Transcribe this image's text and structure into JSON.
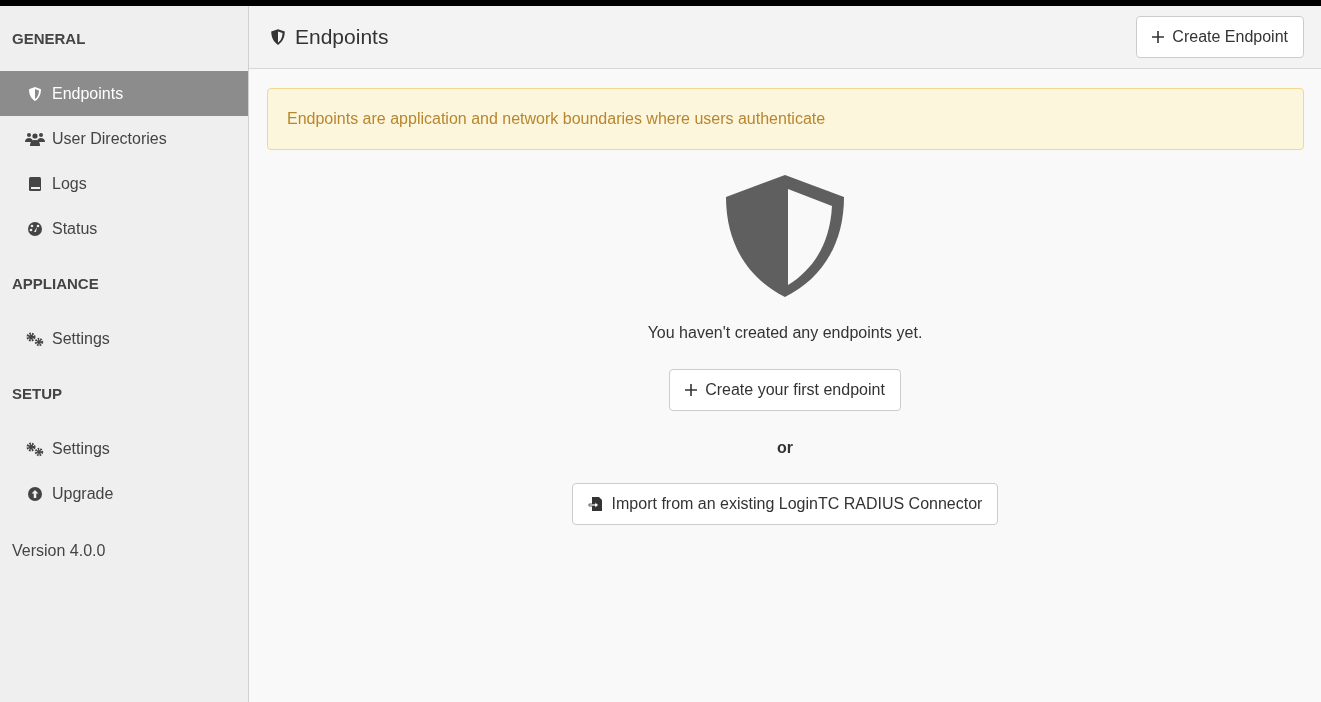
{
  "sidebar": {
    "sections": [
      {
        "heading": "GENERAL",
        "items": [
          {
            "label": "Endpoints",
            "kind": "shield",
            "selected": true
          },
          {
            "label": "User Directories",
            "kind": "users",
            "selected": false
          },
          {
            "label": "Logs",
            "kind": "book",
            "selected": false
          },
          {
            "label": "Status",
            "kind": "gauge",
            "selected": false
          }
        ]
      },
      {
        "heading": "APPLIANCE",
        "items": [
          {
            "label": "Settings",
            "kind": "gears",
            "selected": false
          }
        ]
      },
      {
        "heading": "SETUP",
        "items": [
          {
            "label": "Settings",
            "kind": "gears",
            "selected": false
          },
          {
            "label": "Upgrade",
            "kind": "upgrade",
            "selected": false
          }
        ]
      }
    ],
    "version": "Version 4.0.0"
  },
  "header": {
    "title": "Endpoints",
    "button": "Create Endpoint"
  },
  "alert": "Endpoints are application and network boundaries where users authenticate",
  "empty_state": {
    "message": "You haven't created any endpoints yet.",
    "create_button": "Create your first endpoint",
    "separator": "or",
    "import_button": "Import from an existing LoginTC RADIUS Connector"
  }
}
